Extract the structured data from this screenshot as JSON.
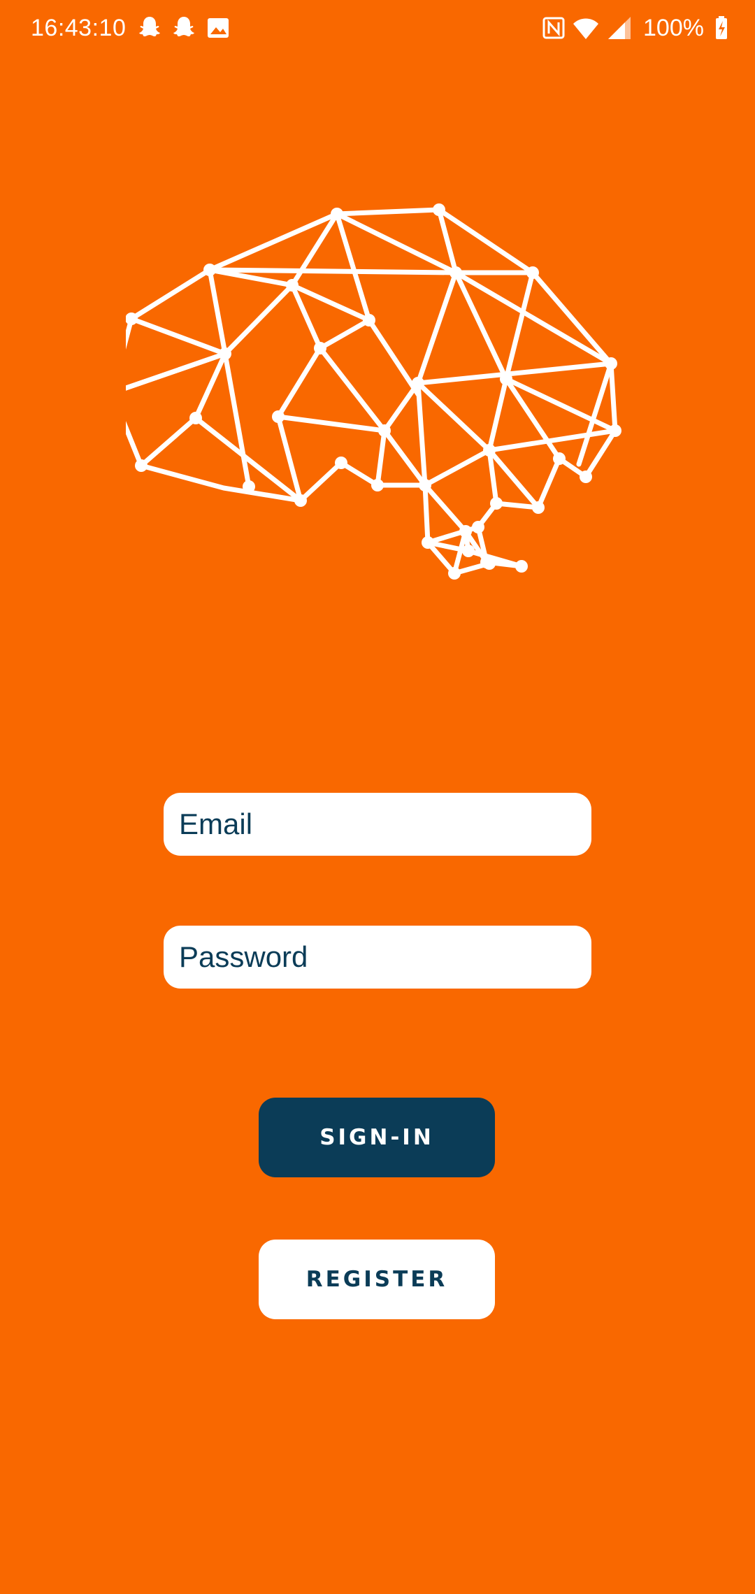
{
  "status_bar": {
    "time": "16:43:10",
    "battery": "100%",
    "icons": [
      "snapchat-icon",
      "snapchat-icon",
      "gallery-icon",
      "nfc-icon",
      "wifi-icon",
      "signal-icon",
      "battery-charging-icon"
    ]
  },
  "logo": {
    "icon": "brain-network-icon",
    "color": "#FFFFFF"
  },
  "form": {
    "email": {
      "value": "",
      "placeholder": "Email"
    },
    "password": {
      "value": "",
      "placeholder": "Password"
    }
  },
  "buttons": {
    "signin_label": "SIGN-IN",
    "register_label": "REGISTER"
  },
  "colors": {
    "background": "#F96800",
    "primary": "#0B3C57",
    "surface": "#FFFFFF"
  }
}
